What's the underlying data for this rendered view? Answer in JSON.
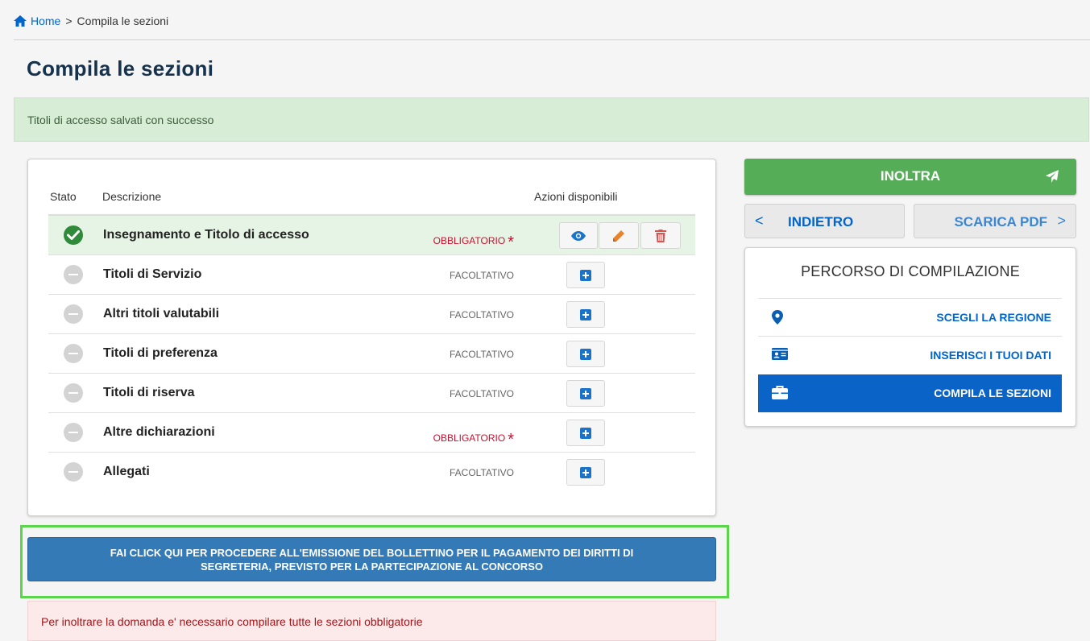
{
  "breadcrumb": {
    "home": "Home",
    "separator": ">",
    "current": "Compila le sezioni"
  },
  "page_title": "Compila le sezioni",
  "success_message": "Titoli di accesso salvati con successo",
  "table": {
    "headers": {
      "stato": "Stato",
      "descrizione": "Descrizione",
      "azioni": "Azioni disponibili"
    },
    "rows": [
      {
        "description": "Insegnamento e Titolo di accesso",
        "requirement": "OBBLIGATORIO",
        "status": "completed"
      },
      {
        "description": "Titoli di Servizio",
        "requirement": "FACOLTATIVO",
        "status": "pending"
      },
      {
        "description": "Altri titoli valutabili",
        "requirement": "FACOLTATIVO",
        "status": "pending"
      },
      {
        "description": "Titoli di preferenza",
        "requirement": "FACOLTATIVO",
        "status": "pending"
      },
      {
        "description": "Titoli di riserva",
        "requirement": "FACOLTATIVO",
        "status": "pending"
      },
      {
        "description": "Altre dichiarazioni",
        "requirement": "OBBLIGATORIO",
        "status": "pending"
      },
      {
        "description": "Allegati",
        "requirement": "FACOLTATIVO",
        "status": "pending"
      }
    ],
    "required_star": "*"
  },
  "bollettino_button": {
    "line1": "FAI CLICK QUI PER PROCEDERE ALL'EMISSIONE DEL BOLLETTINO PER IL PAGAMENTO DEI DIRITTI DI",
    "line2": "SEGRETERIA, PREVISTO PER LA PARTECIPAZIONE AL CONCORSO"
  },
  "error_message": "Per inoltrare la domanda e' necessario compilare tutte le sezioni obbligatorie",
  "actions": {
    "inoltra": "INOLTRA",
    "indietro": "INDIETRO",
    "scarica_pdf": "SCARICA PDF",
    "chevron_left": "<",
    "chevron_right": ">"
  },
  "percorso": {
    "title": "PERCORSO DI COMPILAZIONE",
    "steps": [
      {
        "label": "SCEGLI LA REGIONE",
        "icon": "map-marker-icon",
        "active": false
      },
      {
        "label": "INSERISCI I TUOI DATI",
        "icon": "id-card-icon",
        "active": false
      },
      {
        "label": "COMPILA LE SEZIONI",
        "icon": "briefcase-icon",
        "active": true
      }
    ]
  },
  "colors": {
    "success_bg": "#d7edd6",
    "primary": "#0066cc",
    "mandatory": "#c8102e",
    "inoltra": "#56ad57",
    "highlight_frame": "#5ad64a",
    "active_step": "#0a63c7"
  }
}
